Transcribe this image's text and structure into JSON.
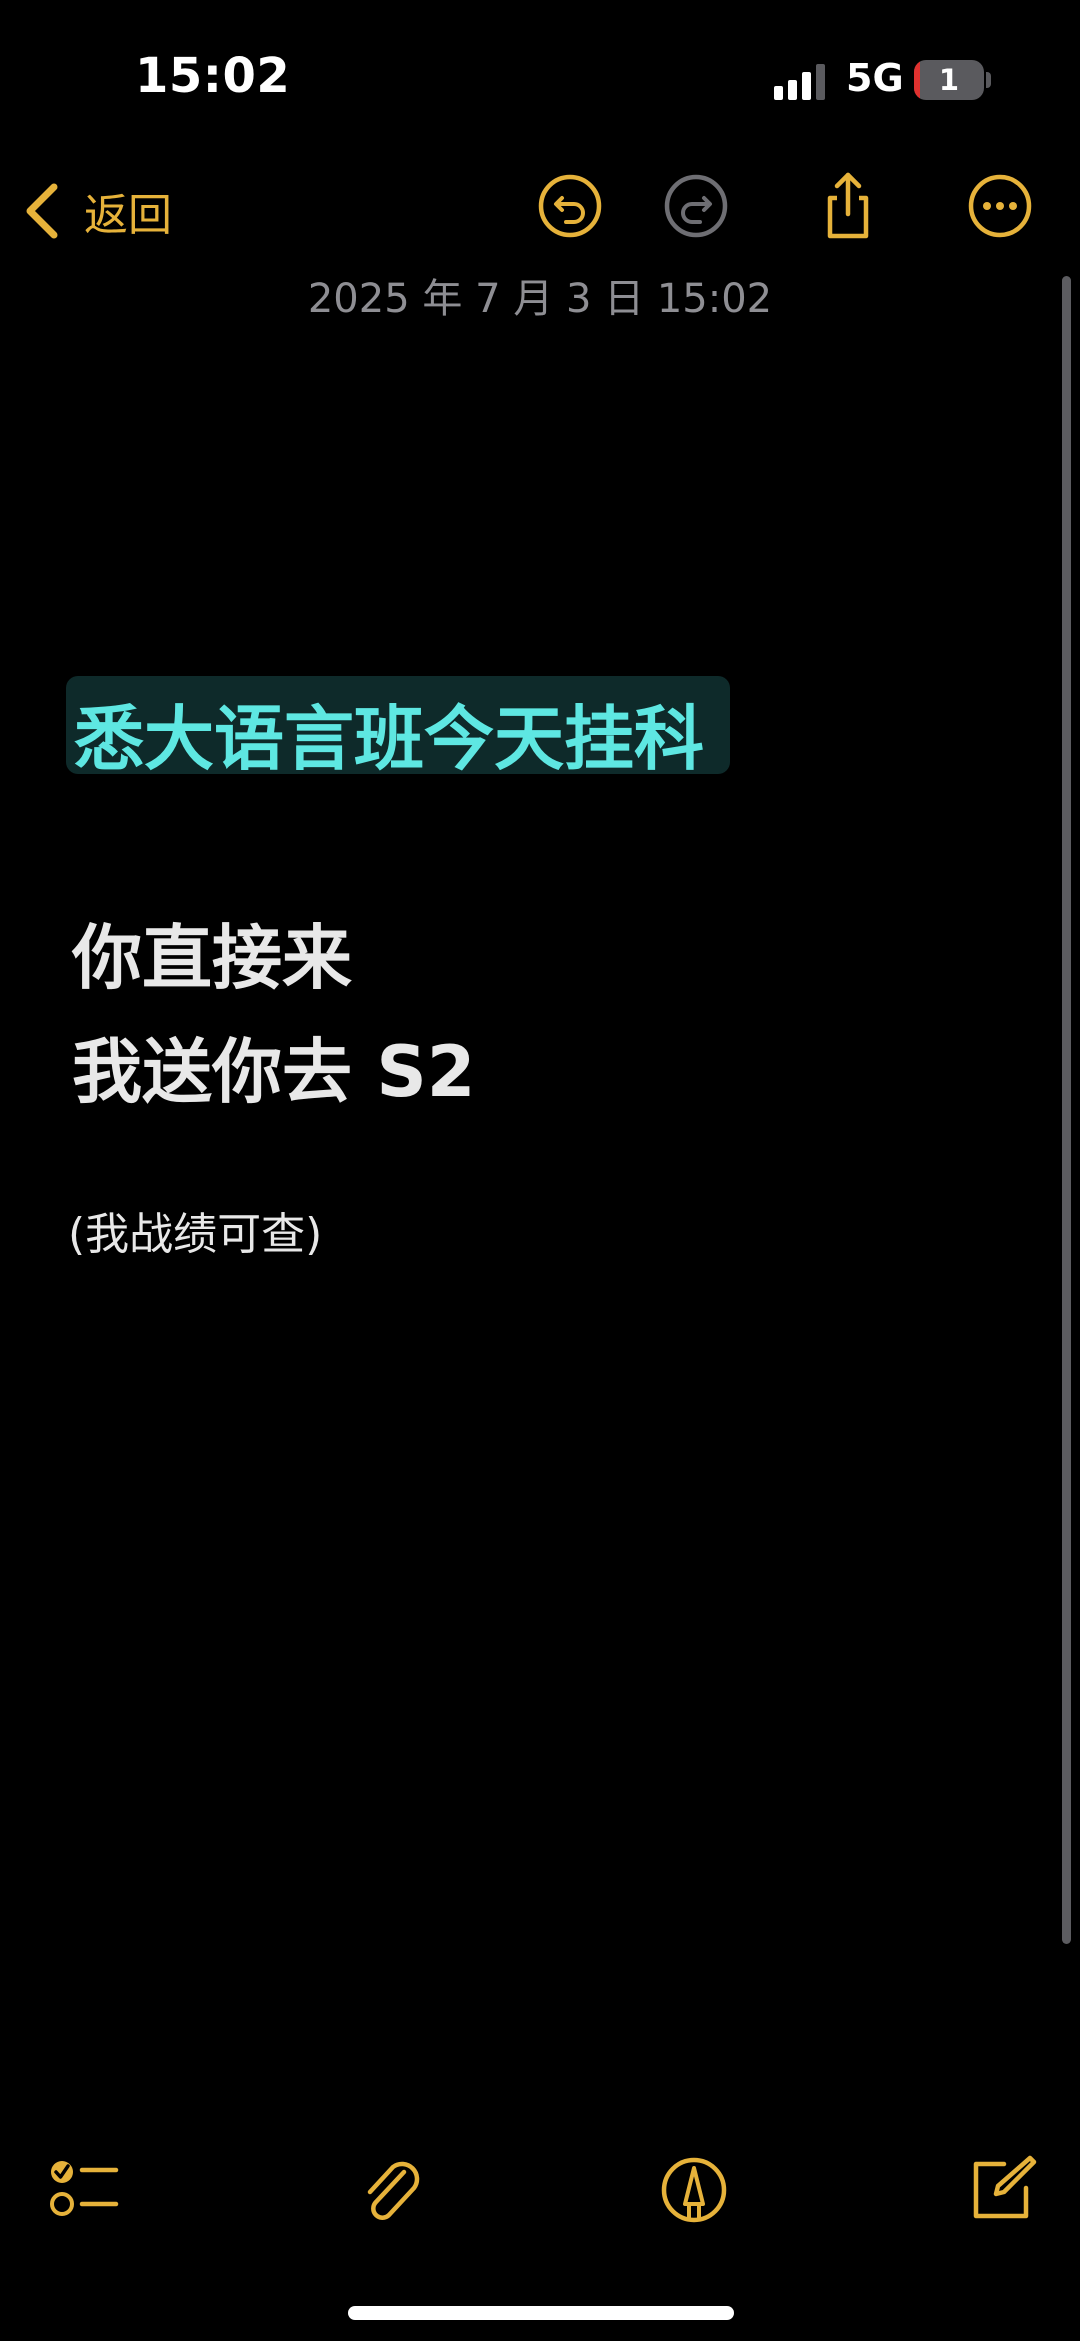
{
  "status_bar": {
    "time": "15:02",
    "network": "5G",
    "battery_level": "1",
    "signal_bars_filled": 3,
    "signal_bars_total": 4
  },
  "nav": {
    "back_label": "返回",
    "icons": [
      "back-chevron-icon",
      "undo-icon",
      "redo-icon",
      "share-icon",
      "more-icon"
    ]
  },
  "note": {
    "date": "2025 年 7 月 3 日 15:02",
    "heading": "悉大语言班今天挂科",
    "line1": "你直接来",
    "line2": "我送你去 S2",
    "remark": "(我战绩可查)"
  },
  "toolbar": {
    "icons": [
      "checklist-icon",
      "attachment-icon",
      "markup-icon",
      "compose-icon"
    ]
  },
  "colors": {
    "accent": "#e6b23a",
    "background": "#000000",
    "heading_text": "#5ee7e2",
    "heading_highlight": "#0e2a2a",
    "body_text": "#e8e8e8",
    "secondary_text": "#8e8e93",
    "disabled_icon": "#6e6e73"
  }
}
